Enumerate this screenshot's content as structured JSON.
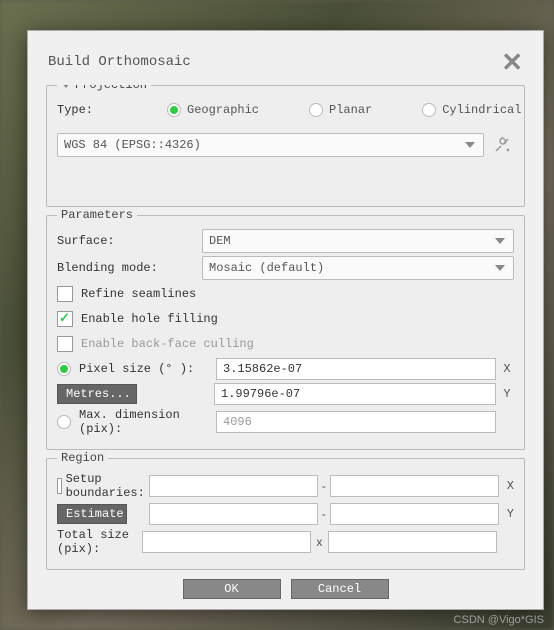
{
  "dialog": {
    "title": "Build Orthomosaic"
  },
  "projection": {
    "group_title": "Projection",
    "type_label": "Type:",
    "options": {
      "geographic": "Geographic",
      "planar": "Planar",
      "cylindrical": "Cylindrical"
    },
    "crs": "WGS 84 (EPSG::4326)"
  },
  "parameters": {
    "group_title": "Parameters",
    "surface_label": "Surface:",
    "surface_value": "DEM",
    "blending_label": "Blending mode:",
    "blending_value": "Mosaic (default)",
    "refine_label": "Refine seamlines",
    "holefill_label": "Enable hole filling",
    "backface_label": "Enable back-face culling",
    "pixel_size_label": "Pixel size (° ):",
    "pixel_size_x": "3.15862e-07",
    "pixel_size_y": "1.99796e-07",
    "metres_btn": "Metres...",
    "max_dim_label": "Max. dimension (pix):",
    "max_dim_value": "4096",
    "suffix_x": "X",
    "suffix_y": "Y"
  },
  "region": {
    "group_title": "Region",
    "setup_label": "Setup boundaries:",
    "estimate_btn": "Estimate",
    "total_label": "Total size (pix):",
    "suffix_x": "X",
    "suffix_y": "Y",
    "sep_x": "x",
    "sep_dash": "-"
  },
  "footer": {
    "ok": "OK",
    "cancel": "Cancel"
  },
  "watermark": "CSDN @Vigo*GIS"
}
